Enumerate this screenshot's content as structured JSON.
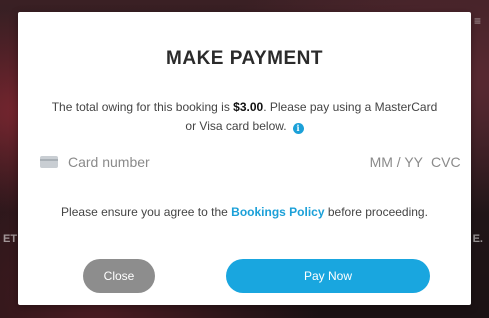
{
  "background": {
    "left_edge_text": "ET",
    "right_edge_text": "E.",
    "top_right_text": "≡"
  },
  "modal": {
    "title": "MAKE PAYMENT",
    "message_prefix": "The total owing for this booking is ",
    "amount": "$3.00",
    "message_suffix": ". Please pay using a MasterCard or Visa card below.",
    "info_icon_glyph": "i",
    "card_form": {
      "card_number_placeholder": "Card number",
      "expiry_placeholder": "MM / YY",
      "cvc_placeholder": "CVC"
    },
    "agree_prefix": "Please ensure you agree to the ",
    "policy_link_text": "Bookings Policy",
    "agree_suffix": " before proceeding.",
    "close_label": "Close",
    "pay_label": "Pay Now"
  },
  "colors": {
    "accent": "#19a6df",
    "close_button": "#8d8d8d"
  }
}
